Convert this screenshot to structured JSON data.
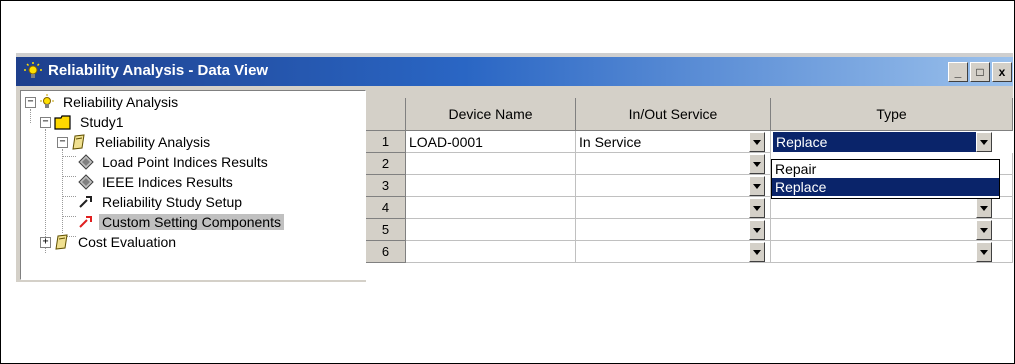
{
  "window": {
    "title": "Reliability Analysis - Data View",
    "controls": {
      "minimize": "_",
      "maximize": "□",
      "close": "x"
    }
  },
  "tree": [
    {
      "label": "Reliability Analysis",
      "icon": "reliability-bulb-icon",
      "expander": "−"
    },
    {
      "label": "Study1",
      "icon": "folder-icon",
      "expander": "−"
    },
    {
      "label": "Reliability Analysis",
      "icon": "analysis-folder-icon",
      "expander": "−"
    },
    {
      "label": "Load Point Indices Results",
      "icon": "results-icon"
    },
    {
      "label": "IEEE Indices Results",
      "icon": "results-icon"
    },
    {
      "label": "Reliability Study Setup",
      "icon": "setup-icon"
    },
    {
      "label": "Custom Setting Components",
      "icon": "custom-setup-icon",
      "selected": true
    },
    {
      "label": "Cost Evaluation",
      "icon": "analysis-folder-icon",
      "expander": "+"
    }
  ],
  "grid": {
    "columns": [
      "Device Name",
      "In/Out Service",
      "Type"
    ],
    "rows": [
      {
        "num": "1",
        "device": "LOAD-0001",
        "service": "In Service",
        "type": "Replace"
      },
      {
        "num": "2",
        "device": "",
        "service": "",
        "type": ""
      },
      {
        "num": "3",
        "device": "",
        "service": "",
        "type": ""
      },
      {
        "num": "4",
        "device": "",
        "service": "",
        "type": ""
      },
      {
        "num": "5",
        "device": "",
        "service": "",
        "type": ""
      },
      {
        "num": "6",
        "device": "",
        "service": "",
        "type": ""
      }
    ],
    "type_dropdown": {
      "options": [
        "Repair",
        "Replace"
      ],
      "selected": "Replace"
    }
  },
  "colors": {
    "title_start": "#1e3f8c",
    "title_end": "#9bc1ec",
    "selection": "#0a246a",
    "chrome": "#d4d0c8"
  }
}
